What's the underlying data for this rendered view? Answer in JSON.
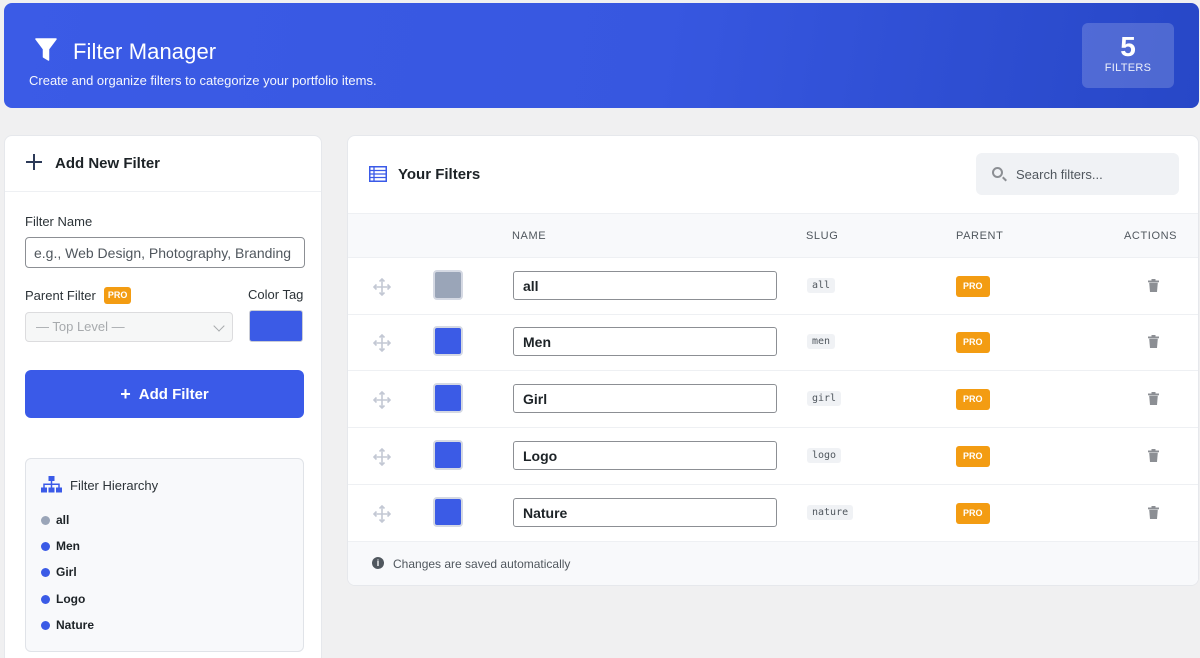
{
  "header": {
    "title": "Filter Manager",
    "subtitle": "Create and organize filters to categorize your portfolio items.",
    "count": "5",
    "count_label": "FILTERS",
    "icon": "funnel-icon"
  },
  "add_filter": {
    "title": "Add New Filter",
    "name_label": "Filter Name",
    "name_placeholder": "e.g., Web Design, Photography, Branding",
    "parent_label": "Parent Filter",
    "pro_badge": "PRO",
    "parent_value": "— Top Level —",
    "color_label": "Color Tag",
    "color_value": "#3b5be6",
    "button_label": "Add Filter"
  },
  "hierarchy": {
    "title": "Filter Hierarchy",
    "items": [
      {
        "label": "all",
        "color": "#9aa5b8"
      },
      {
        "label": "Men",
        "color": "#3b5be6"
      },
      {
        "label": "Girl",
        "color": "#3b5be6"
      },
      {
        "label": "Logo",
        "color": "#3b5be6"
      },
      {
        "label": "Nature",
        "color": "#3b5be6"
      }
    ]
  },
  "filters_table": {
    "title": "Your Filters",
    "search_placeholder": "Search filters...",
    "columns": {
      "name": "NAME",
      "slug": "SLUG",
      "parent": "PARENT",
      "actions": "ACTIONS"
    },
    "rows": [
      {
        "name": "all",
        "slug": "all",
        "parent": "PRO",
        "color": "#9aa5b8"
      },
      {
        "name": "Men",
        "slug": "men",
        "parent": "PRO",
        "color": "#3b5be6"
      },
      {
        "name": "Girl",
        "slug": "girl",
        "parent": "PRO",
        "color": "#3b5be6"
      },
      {
        "name": "Logo",
        "slug": "logo",
        "parent": "PRO",
        "color": "#3b5be6"
      },
      {
        "name": "Nature",
        "slug": "nature",
        "parent": "PRO",
        "color": "#3b5be6"
      }
    ],
    "footer_note": "Changes are saved automatically"
  },
  "colors": {
    "accent": "#3a5ae8",
    "pro": "#f39c12"
  }
}
